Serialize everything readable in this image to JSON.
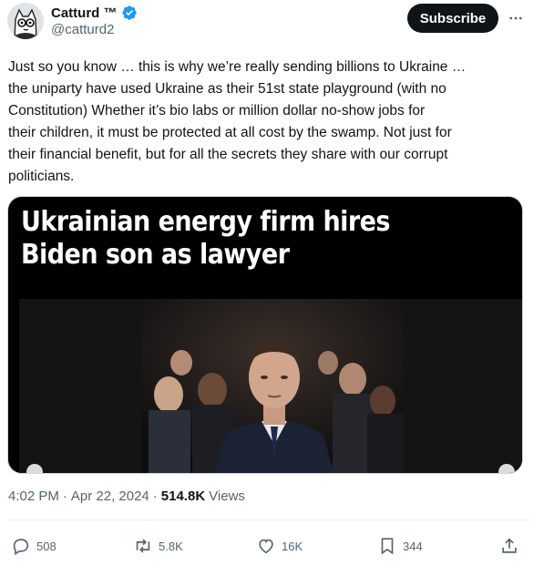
{
  "author": {
    "name": "Catturd ™",
    "handle": "@catturd2",
    "verified": true,
    "badge_color": "#1d9bf0"
  },
  "subscribe_label": "Subscribe",
  "tweet": {
    "text": "Just so you know … this is why we’re really sending billions to Ukraine …\nthe uniparty have used Ukraine as their 51st state playground (with no\nConstitution) Whether it’s bio labs or million dollar no-show jobs for\ntheir children, it must be protected at all cost by the swamp. Not just for\ntheir financial benefit, but for all the secrets they share with our corrupt\npoliticians."
  },
  "media": {
    "headline": "Ukrainian energy firm hires Biden son as lawyer"
  },
  "meta": {
    "time": "4:02 PM",
    "separator": "·",
    "date": "Apr 22, 2024",
    "views_count": "514.8K",
    "views_label": "Views"
  },
  "actions": {
    "replies": "508",
    "reposts": "5.8K",
    "likes": "16K",
    "bookmarks": "344"
  },
  "icons": {
    "verified": "verified-badge-icon",
    "more": "more-dots-icon",
    "reply": "reply-icon",
    "repost": "repost-icon",
    "like": "heart-icon",
    "bookmark": "bookmark-icon",
    "share": "share-icon"
  }
}
